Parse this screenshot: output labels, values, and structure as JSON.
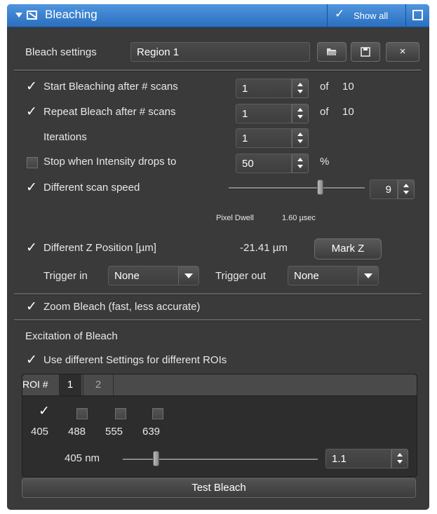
{
  "title_bar": {
    "title": "Bleaching",
    "show_all_label": "Show all",
    "show_all_checked": true
  },
  "bleach_settings": {
    "label": "Bleach settings",
    "value": "Region 1",
    "open_icon": "folder-open-icon",
    "save_icon": "floppy-disk-icon",
    "close_label": "×"
  },
  "start_bleaching": {
    "checked": true,
    "label": "Start Bleaching after # scans",
    "value": "1",
    "of_label": "of",
    "total": "10"
  },
  "repeat_bleach": {
    "checked": true,
    "label": "Repeat Bleach after # scans",
    "value": "1",
    "of_label": "of",
    "total": "10"
  },
  "iterations": {
    "label": "Iterations",
    "value": "1"
  },
  "stop_intensity": {
    "checked": false,
    "label": "Stop when Intensity drops to",
    "value": "50",
    "unit": "%"
  },
  "scan_speed": {
    "checked": true,
    "label": "Different scan speed",
    "value": "9",
    "slider_level": 0.67,
    "pixel_dwell_label": "Pixel Dwell",
    "pixel_dwell_value": "1.60 µsec"
  },
  "z_position": {
    "checked": true,
    "label": "Different Z Position [µm]",
    "value": "-21.41 µm",
    "mark_button": "Mark Z"
  },
  "triggers": {
    "in_label": "Trigger in",
    "in_value": "None",
    "out_label": "Trigger out",
    "out_value": "None"
  },
  "zoom_bleach": {
    "checked": true,
    "label": "Zoom Bleach (fast, less accurate)"
  },
  "excitation": {
    "heading": "Excitation of Bleach",
    "use_different": {
      "checked": true,
      "label": "Use different Settings for different ROIs"
    }
  },
  "roi": {
    "label": "ROI #",
    "tabs": [
      "1",
      "2"
    ],
    "active_tab": "1",
    "lasers": [
      {
        "wavelength": "405",
        "checked": true
      },
      {
        "wavelength": "488",
        "checked": false
      },
      {
        "wavelength": "555",
        "checked": false
      },
      {
        "wavelength": "639",
        "checked": false
      }
    ],
    "power_label": "405 nm",
    "power_value": "1.1",
    "power_slider_level": 0.17
  },
  "test_bleach_label": "Test Bleach"
}
